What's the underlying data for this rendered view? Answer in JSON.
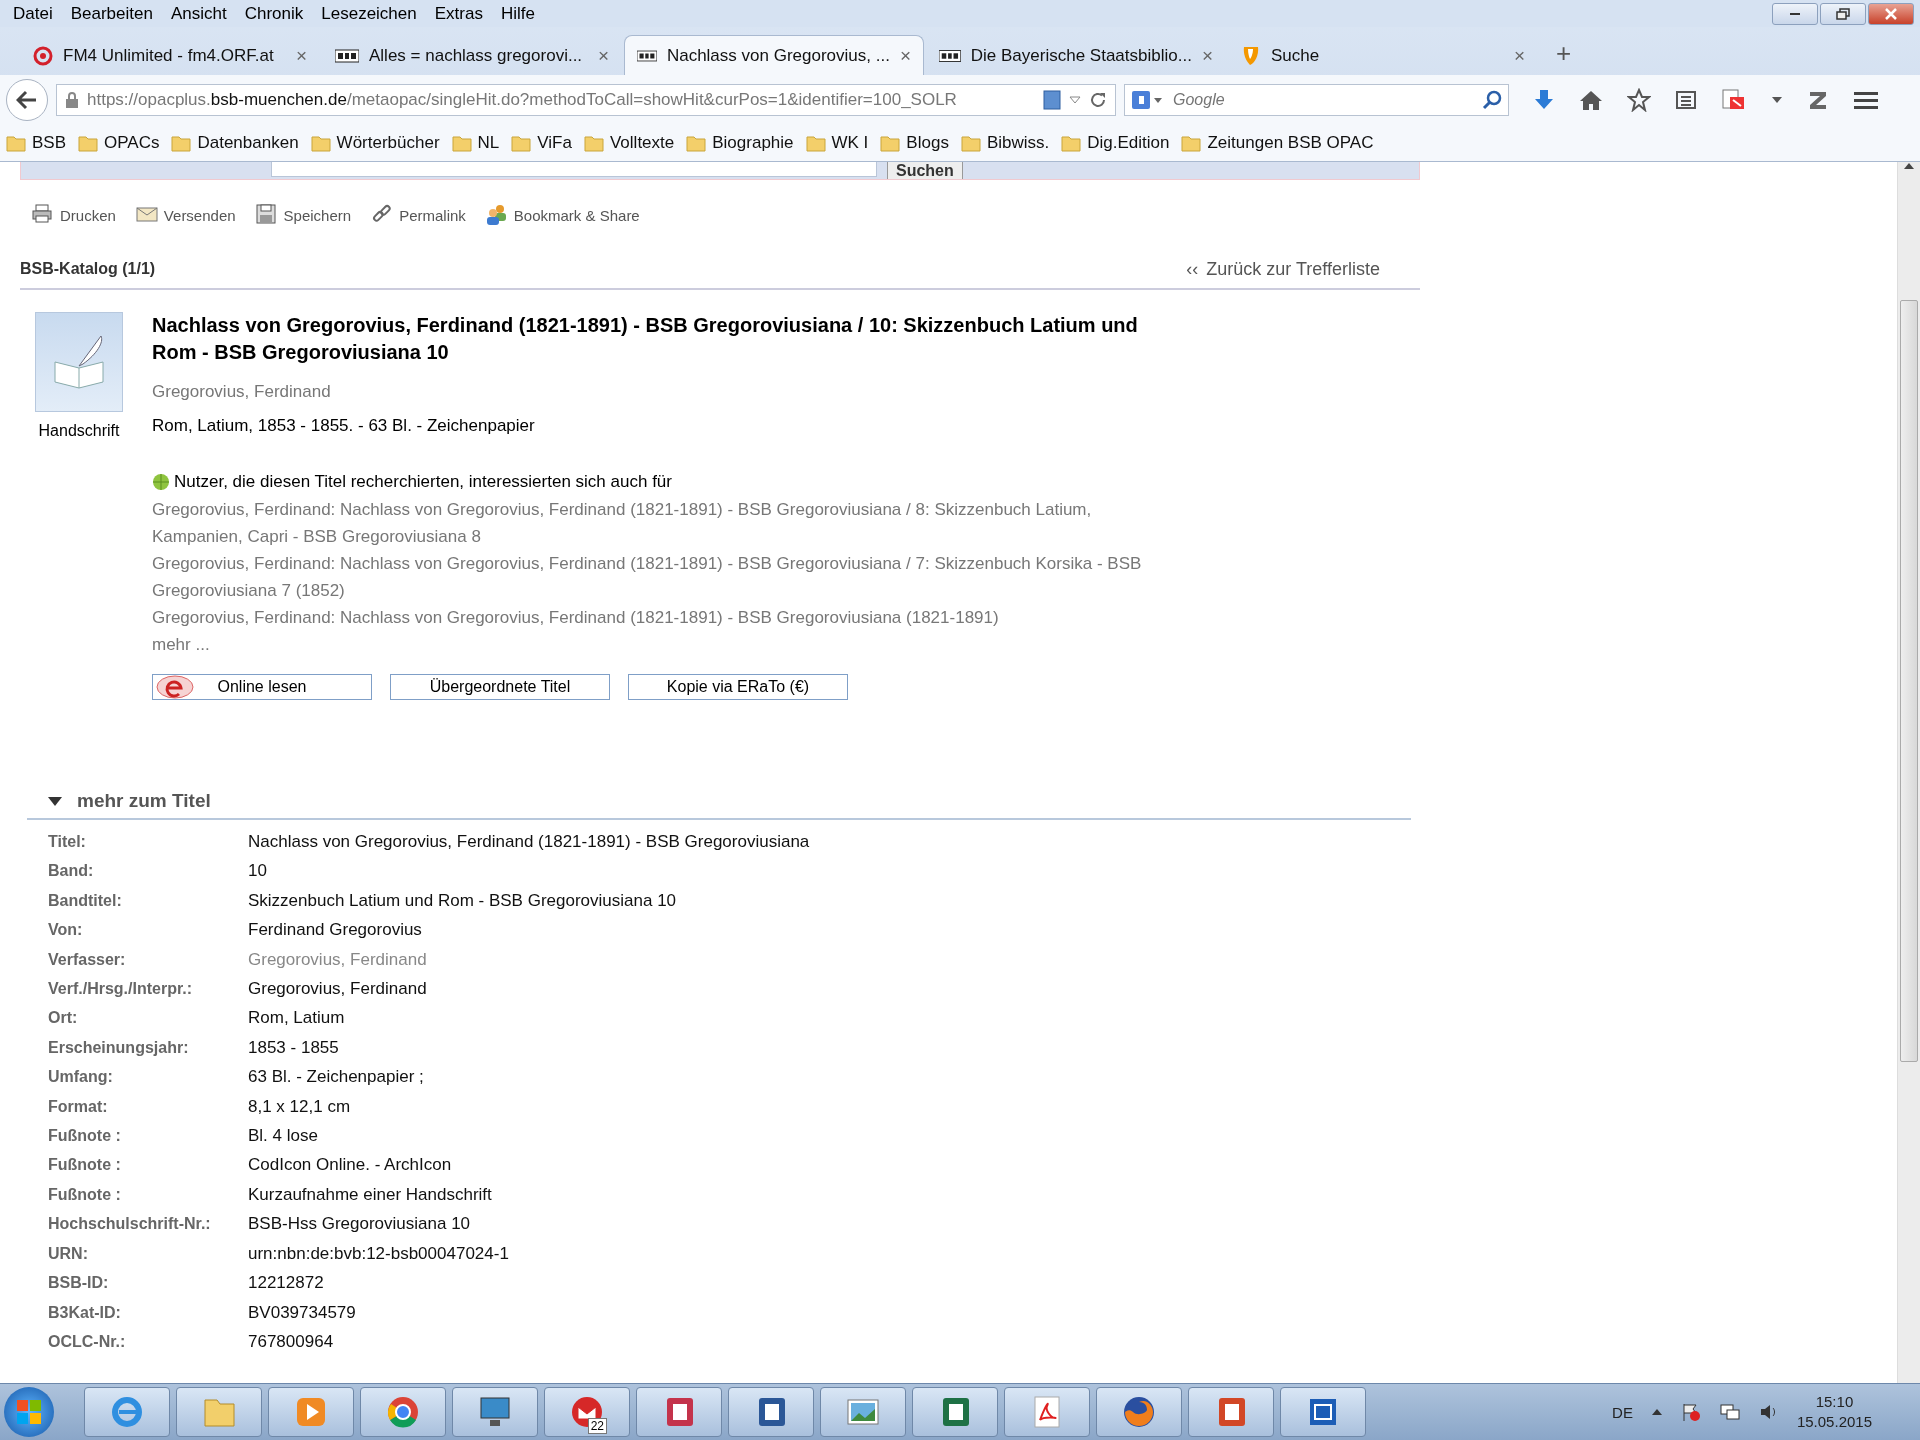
{
  "menu": [
    "Datei",
    "Bearbeiten",
    "Ansicht",
    "Chronik",
    "Lesezeichen",
    "Extras",
    "Hilfe"
  ],
  "tabs": [
    {
      "title": "FM4 Unlimited - fm4.ORF.at",
      "close": "×",
      "selected": false
    },
    {
      "title": "Alles = nachlass gregorovi...",
      "close": "×",
      "selected": false
    },
    {
      "title": "Nachlass von Gregorovius, ...",
      "close": "×",
      "selected": true
    },
    {
      "title": "Die Bayerische Staatsbiblio...",
      "close": "×",
      "selected": false
    },
    {
      "title": "Suche",
      "close": "×",
      "selected": false
    }
  ],
  "new_tab": "+",
  "address": {
    "prefix": "https://opacplus.",
    "domain": "bsb-muenchen.de",
    "path": "/metaopac/singleHit.do?methodToCall=showHit&curPos=1&identifier=100_SOLR"
  },
  "search": {
    "placeholder": "Google"
  },
  "bookmarks": [
    "BSB",
    "OPACs",
    "Datenbanken",
    "Wörterbücher",
    "NL",
    "ViFa",
    "Volltexte",
    "Biographie",
    "WK I",
    "Blogs",
    "Bibwiss.",
    "Dig.Edition",
    "Zeitungen BSB OPAC"
  ],
  "page": {
    "search_button": "Suchen",
    "actions": [
      "Drucken",
      "Versenden",
      "Speichern",
      "Permalink",
      "Bookmark & Share"
    ],
    "catalog": "BSB-Katalog (1/1)",
    "back_arrow": "‹‹",
    "back_link": "Zurück zur Trefferliste",
    "record": {
      "title": "Nachlass von Gregorovius, Ferdinand (1821-1891) - BSB Gregoroviusiana / 10: Skizzenbuch Latium und Rom - BSB Gregoroviusiana 10",
      "type_label": "Handschrift",
      "author": "Gregorovius, Ferdinand",
      "description": "Rom, Latium, 1853 - 1855. - 63 Bl. - Zeichenpapier",
      "related_heading": "Nutzer, die diesen Titel recherchierten, interessierten sich auch für",
      "related": [
        "Gregorovius, Ferdinand: Nachlass von Gregorovius, Ferdinand (1821-1891) - BSB Gregoroviusiana / 8: Skizzenbuch Latium, Kampanien, Capri - BSB Gregoroviusiana 8",
        "Gregorovius, Ferdinand: Nachlass von Gregorovius, Ferdinand (1821-1891) - BSB Gregoroviusiana / 7: Skizzenbuch Korsika - BSB Gregoroviusiana 7 (1852)",
        "Gregorovius, Ferdinand: Nachlass von Gregorovius, Ferdinand (1821-1891) - BSB Gregoroviusiana (1821-1891)"
      ],
      "more": "mehr ...",
      "buttons": [
        {
          "label": "Online lesen",
          "kind": "online"
        },
        {
          "label": "Übergeordnete Titel",
          "kind": "plain"
        },
        {
          "label": "Kopie via ERaTo (€)",
          "kind": "plain"
        }
      ]
    },
    "details": {
      "heading": "mehr zum Titel",
      "expanded": true,
      "rows": [
        {
          "label": "Titel:",
          "value": "Nachlass von Gregorovius, Ferdinand (1821-1891) - BSB Gregoroviusiana",
          "link": false
        },
        {
          "label": "Band:",
          "value": "10",
          "link": false
        },
        {
          "label": "Bandtitel:",
          "value": "Skizzenbuch Latium und Rom - BSB Gregoroviusiana 10",
          "link": false
        },
        {
          "label": "Von:",
          "value": "Ferdinand Gregorovius",
          "link": false
        },
        {
          "label": "Verfasser:",
          "value": "Gregorovius, Ferdinand",
          "link": true
        },
        {
          "label": "Verf./Hrsg./Interpr.:",
          "value": "Gregorovius, Ferdinand",
          "link": false
        },
        {
          "label": "Ort:",
          "value": "Rom, Latium",
          "link": false
        },
        {
          "label": "Erscheinungsjahr:",
          "value": "1853 - 1855",
          "link": false
        },
        {
          "label": "Umfang:",
          "value": "63 Bl. - Zeichenpapier ;",
          "link": false
        },
        {
          "label": "Format:",
          "value": "8,1 x 12,1 cm",
          "link": false
        },
        {
          "label": "Fußnote :",
          "value": "Bl. 4 lose",
          "link": false
        },
        {
          "label": "Fußnote :",
          "value": "CodIcon Online. - ArchIcon",
          "link": false
        },
        {
          "label": "Fußnote :",
          "value": "Kurzaufnahme einer Handschrift",
          "link": false
        },
        {
          "label": "Hochschulschrift-Nr.:",
          "value": "BSB-Hss Gregoroviusiana 10",
          "link": false
        },
        {
          "label": "URN:",
          "value": "urn:nbn:de:bvb:12-bsb00047024-1",
          "link": false
        },
        {
          "label": "BSB-ID:",
          "value": "12212872",
          "link": false
        },
        {
          "label": "B3Kat-ID:",
          "value": "BV039734579",
          "link": false
        },
        {
          "label": "OCLC-Nr.:",
          "value": "767800964",
          "link": false
        }
      ]
    }
  },
  "taskbar": {
    "apps": [
      {
        "kind": "ie"
      },
      {
        "kind": "folder"
      },
      {
        "kind": "media"
      },
      {
        "kind": "chrome"
      },
      {
        "kind": "monitor"
      },
      {
        "kind": "mail",
        "badge": "22"
      },
      {
        "kind": "access"
      },
      {
        "kind": "word"
      },
      {
        "kind": "photo"
      },
      {
        "kind": "excel"
      },
      {
        "kind": "pdf"
      },
      {
        "kind": "firefox"
      },
      {
        "kind": "powerpoint"
      },
      {
        "kind": "window"
      }
    ],
    "language": "DE",
    "time": "15:10",
    "date": "15.05.2015"
  }
}
